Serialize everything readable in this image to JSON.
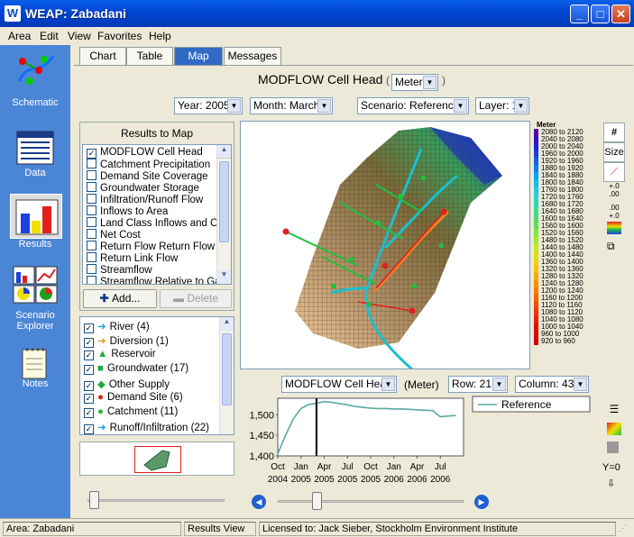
{
  "window": {
    "title": "WEAP:  Zabadani",
    "app_icon": "W"
  },
  "menu": [
    "Area",
    "Edit",
    "View",
    "Favorites",
    "Help"
  ],
  "left_bar": [
    "Schematic",
    "Data",
    "Results",
    "Scenario Explorer",
    "Notes"
  ],
  "tabs": [
    "Chart",
    "Table",
    "Map",
    "Messages"
  ],
  "map_title": "MODFLOW Cell Head",
  "unit_select": {
    "value": "Meter"
  },
  "year": "Year: 2005",
  "month": "Month: March",
  "scenario": "Scenario: Reference",
  "layer": "Layer: 1",
  "results_panel": {
    "title": "Results to Map",
    "items": [
      "MODFLOW Cell Head",
      "Catchment Precipitation",
      "Demand Site Coverage",
      "Groundwater Storage",
      "Infiltration/Runoff Flow",
      "Inflows to Area",
      "Land Class Inflows and Outf",
      "Net Cost",
      "Return Flow Return Flow Ro",
      "Return Link Flow",
      "Streamflow",
      "Streamflow Relative to Gaug"
    ],
    "add_label": "Add...",
    "delete_label": "Delete"
  },
  "layers": [
    {
      "label": "River (4)",
      "icon": "arrow-right-icon",
      "color": "#1f9be0"
    },
    {
      "label": "Diversion (1)",
      "icon": "arrow-right-icon",
      "color": "#e09a1f"
    },
    {
      "label": "Reservoir",
      "icon": "triangle-icon",
      "color": "#1faa3a"
    },
    {
      "label": "Groundwater (17)",
      "icon": "square-icon",
      "color": "#1faa3a"
    },
    {
      "label": "Other Supply",
      "icon": "diamond-icon",
      "color": "#1faa3a"
    },
    {
      "label": "Demand Site (6)",
      "icon": "circle-icon",
      "color": "#e02020"
    },
    {
      "label": "Catchment (11)",
      "icon": "circle-icon",
      "color": "#1fbf3a"
    },
    {
      "label": "Runoff/Infiltration (22)",
      "icon": "arrow-right-icon",
      "color": "#1f9be0"
    }
  ],
  "legend": {
    "title": "Meter",
    "rows": [
      "2080 to 2120",
      "2040 to 2080",
      "2000 to 2040",
      "1960 to 2000",
      "1920 to 1960",
      "1880 to 1920",
      "1840 to 1880",
      "1800 to 1840",
      "1760 to 1800",
      "1720 to 1760",
      "1680 to 1720",
      "1640 to 1680",
      "1600 to 1640",
      "1560 to 1600",
      "1520 to 1560",
      "1480 to 1520",
      "1440 to 1480",
      "1400 to 1440",
      "1360 to 1400",
      "1320 to 1360",
      "1280 to 1320",
      "1240 to 1280",
      "1200 to 1240",
      "1160 to 1200",
      "1120 to 1160",
      "1080 to 1120",
      "1040 to 1080",
      "1000 to 1040",
      "960 to 1000",
      "920 to 960"
    ],
    "colors": [
      "#5a00a0",
      "#3a10c0",
      "#2020d8",
      "#1840e0",
      "#1060e8",
      "#0a80ec",
      "#08a0f0",
      "#10b8f0",
      "#20c8e8",
      "#30d0d0",
      "#30d8b0",
      "#40d890",
      "#50d870",
      "#60e050",
      "#80e840",
      "#a0e830",
      "#c0e820",
      "#dde010",
      "#f0d010",
      "#f8c000",
      "#f8a800",
      "#f89000",
      "#f87800",
      "#f86000",
      "#f84800",
      "#f03000",
      "#e82000",
      "#e01000",
      "#d80800",
      "#d00000"
    ]
  },
  "right_tools": [
    "#",
    "Size"
  ],
  "bottom_chart": {
    "variable": "MODFLOW Cell Head",
    "unit": "(Meter)",
    "row": "Row:  21",
    "column": "Column:  43",
    "y0_label": "Y=0"
  },
  "chart_data": {
    "type": "line",
    "series": [
      {
        "name": "Reference",
        "color": "#5aa8a0",
        "x": [
          "2004-10",
          "2004-11",
          "2004-12",
          "2005-01",
          "2005-02",
          "2005-03",
          "2005-04",
          "2005-05",
          "2005-06",
          "2005-07",
          "2005-08",
          "2005-09",
          "2005-10",
          "2005-11",
          "2005-12",
          "2006-01",
          "2006-02",
          "2006-03",
          "2006-04",
          "2006-05",
          "2006-06",
          "2006-07",
          "2006-08",
          "2006-09"
        ],
        "values": [
          1405,
          1450,
          1490,
          1515,
          1525,
          1528,
          1532,
          1530,
          1527,
          1524,
          1520,
          1518,
          1516,
          1515,
          1515,
          1514,
          1514,
          1513,
          1512,
          1511,
          1510,
          1495,
          1497,
          1498
        ]
      }
    ],
    "xticks": [
      {
        "label": [
          "Oct",
          "2004"
        ]
      },
      {
        "label": [
          "Jan",
          "2005"
        ]
      },
      {
        "label": [
          "Apr",
          "2005"
        ]
      },
      {
        "label": [
          "Jul",
          "2005"
        ]
      },
      {
        "label": [
          "Oct",
          "2005"
        ]
      },
      {
        "label": [
          "Jan",
          "2006"
        ]
      },
      {
        "label": [
          "Apr",
          "2006"
        ]
      },
      {
        "label": [
          "Jul",
          "2006"
        ]
      }
    ],
    "yticks": [
      "1,500",
      "1,450",
      "1,400"
    ],
    "ylim": [
      1400,
      1540
    ],
    "marker_month": "2005-03",
    "legend": "Reference"
  },
  "status": [
    "Area: Zabadani",
    "Results View",
    "Licensed to: Jack Sieber, Stockholm Environment Institute"
  ]
}
